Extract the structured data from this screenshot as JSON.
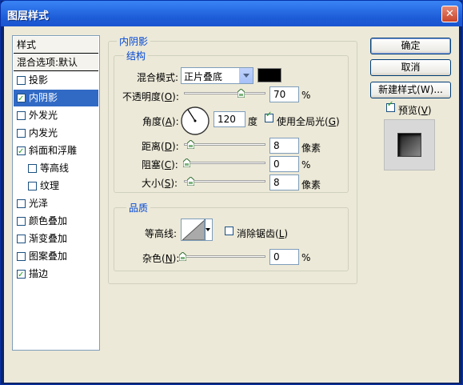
{
  "window": {
    "title": "图层样式",
    "close_glyph": "✕"
  },
  "left_list": {
    "header": "样式",
    "blend_options": "混合选项:默认",
    "items": [
      {
        "label": "投影",
        "checked": false
      },
      {
        "label": "内阴影",
        "checked": true,
        "selected": true
      },
      {
        "label": "外发光",
        "checked": false
      },
      {
        "label": "内发光",
        "checked": false
      },
      {
        "label": "斜面和浮雕",
        "checked": true
      },
      {
        "label": "等高线",
        "checked": false
      },
      {
        "label": "纹理",
        "checked": false
      },
      {
        "label": "光泽",
        "checked": false
      },
      {
        "label": "颜色叠加",
        "checked": false
      },
      {
        "label": "渐变叠加",
        "checked": false
      },
      {
        "label": "图案叠加",
        "checked": false
      },
      {
        "label": "描边",
        "checked": true
      }
    ]
  },
  "inner_shadow": {
    "group_title": "内阴影",
    "structure_title": "结构",
    "blend_mode_label": "混合模式:",
    "blend_mode_value": "正片叠底",
    "shadow_color": "#000000",
    "opacity_label_pre": "不透明度(",
    "opacity_label_key": "O",
    "opacity_label_post": "):",
    "opacity_value": "70",
    "opacity_unit": "%",
    "angle_label_pre": "角度(",
    "angle_label_key": "A",
    "angle_label_post": "):",
    "angle_value": "120",
    "angle_unit": "度",
    "global_light_label_pre": "使用全局光(",
    "global_light_label_key": "G",
    "global_light_label_post": ")",
    "global_light_checked": true,
    "distance_label_pre": "距离(",
    "distance_label_key": "D",
    "distance_label_post": "):",
    "distance_value": "8",
    "distance_unit": "像素",
    "choke_label_pre": "阻塞(",
    "choke_label_key": "C",
    "choke_label_post": "):",
    "choke_value": "0",
    "choke_unit": "%",
    "size_label_pre": "大小(",
    "size_label_key": "S",
    "size_label_post": "):",
    "size_value": "8",
    "size_unit": "像素"
  },
  "quality": {
    "group_title": "品质",
    "contour_label": "等高线:",
    "antialias_label_pre": "消除锯齿(",
    "antialias_label_key": "L",
    "antialias_label_post": ")",
    "antialias_checked": false,
    "noise_label_pre": "杂色(",
    "noise_label_key": "N",
    "noise_label_post": "):",
    "noise_value": "0",
    "noise_unit": "%"
  },
  "buttons": {
    "ok": "确定",
    "cancel": "取消",
    "new_style": "新建样式(W)...",
    "preview_label_pre": "预览(",
    "preview_label_key": "V",
    "preview_label_post": ")",
    "preview_checked": true
  }
}
